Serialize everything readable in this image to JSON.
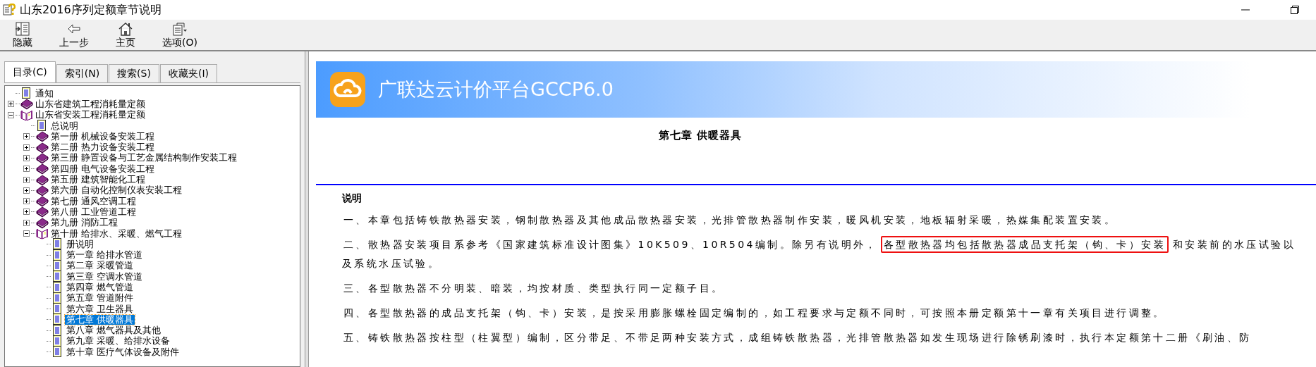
{
  "window": {
    "title": "山东2016序列定额章节说明"
  },
  "toolbar": [
    {
      "label": "隐藏"
    },
    {
      "label": "上一步"
    },
    {
      "label": "主页"
    },
    {
      "label": "选项(O)"
    }
  ],
  "tabs": [
    {
      "label": "目录(C)",
      "selected": true
    },
    {
      "label": "索引(N)",
      "selected": false
    },
    {
      "label": "搜索(S)",
      "selected": false
    },
    {
      "label": "收藏夹(I)",
      "selected": false
    }
  ],
  "tree": [
    {
      "label": "通知",
      "kind": "doc",
      "selected": false
    },
    {
      "label": "山东省建筑工程消耗量定额",
      "kind": "book",
      "expanded": false,
      "selected": false
    },
    {
      "label": "山东省安装工程消耗量定额",
      "kind": "book",
      "expanded": true,
      "selected": false,
      "children": [
        {
          "label": "总说明",
          "kind": "doc",
          "selected": false
        },
        {
          "label": "第一册  机械设备安装工程",
          "kind": "book",
          "expanded": false,
          "selected": false
        },
        {
          "label": "第二册  热力设备安装工程",
          "kind": "book",
          "expanded": false,
          "selected": false
        },
        {
          "label": "第三册  静置设备与工艺金属结构制作安装工程",
          "kind": "book",
          "expanded": false,
          "selected": false
        },
        {
          "label": "第四册  电气设备安装工程",
          "kind": "book",
          "expanded": false,
          "selected": false
        },
        {
          "label": "第五册  建筑智能化工程",
          "kind": "book",
          "expanded": false,
          "selected": false
        },
        {
          "label": "第六册  自动化控制仪表安装工程",
          "kind": "book",
          "expanded": false,
          "selected": false
        },
        {
          "label": "第七册  通风空调工程",
          "kind": "book",
          "expanded": false,
          "selected": false
        },
        {
          "label": "第八册  工业管道工程",
          "kind": "book",
          "expanded": false,
          "selected": false
        },
        {
          "label": "第九册  消防工程",
          "kind": "book",
          "expanded": false,
          "selected": false
        },
        {
          "label": "第十册  给排水、采暖、燃气工程",
          "kind": "book",
          "expanded": true,
          "selected": false,
          "children": [
            {
              "label": "册说明",
              "kind": "doc",
              "selected": false
            },
            {
              "label": "第一章  给排水管道",
              "kind": "doc",
              "selected": false
            },
            {
              "label": "第二章  采暖管道",
              "kind": "doc",
              "selected": false
            },
            {
              "label": "第三章  空调水管道",
              "kind": "doc",
              "selected": false
            },
            {
              "label": "第四章  燃气管道",
              "kind": "doc",
              "selected": false
            },
            {
              "label": "第五章  管道附件",
              "kind": "doc",
              "selected": false
            },
            {
              "label": "第六章  卫生器具",
              "kind": "doc",
              "selected": false
            },
            {
              "label": "第七章  供暖器具",
              "kind": "doc",
              "selected": true
            },
            {
              "label": "第八章  燃气器具及其他",
              "kind": "doc",
              "selected": false
            },
            {
              "label": "第九章  采暖、给排水设备",
              "kind": "doc",
              "selected": false
            },
            {
              "label": "第十章  医疗气体设备及附件",
              "kind": "doc",
              "selected": false
            }
          ]
        }
      ]
    }
  ],
  "content": {
    "banner_title": "广联达云计价平台GCCP6.0",
    "heading": "第七章  供暖器具",
    "section_title": "说明",
    "paragraphs": [
      [
        {
          "text": "一、本章包括铸铁散热器安装，钢制散热器及其他成品散热器安装，光排管散热器制作安装，暖风机安装，地板辐射采暖，热媒集配装置安装。",
          "highlighted": false
        }
      ],
      [
        {
          "text": "二、散热器安装项目系参考《国家建筑标准设计图集》10K509、10R504编制。除另有说明外，",
          "highlighted": false
        },
        {
          "text": "各型散热器均包括散热器成品支托架（钩、卡）安装",
          "highlighted": true
        },
        {
          "text": "和安装前的水压试验以及系统水压试验。",
          "highlighted": false
        }
      ],
      [
        {
          "text": "三、各型散热器不分明装、暗装，均按材质、类型执行同一定额子目。",
          "highlighted": false
        }
      ],
      [
        {
          "text": "四、各型散热器的成品支托架（钩、卡）安装，是按采用膨胀螺栓固定编制的，如工程要求与定额不同时，可按照本册定额第十一章有关项目进行调整。",
          "highlighted": false
        }
      ],
      [
        {
          "text": "五、铸铁散热器按柱型（柱翼型）编制，区分带足、不带足两种安装方式，成组铸铁散热器，光排管散热器如发生现场进行除锈刷漆时，执行本定额第十二册《刷油、防",
          "highlighted": false
        }
      ]
    ]
  }
}
